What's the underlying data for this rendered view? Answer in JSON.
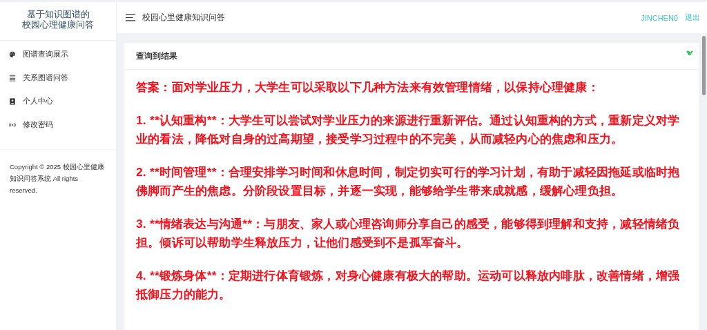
{
  "sidebar": {
    "title_lines": [
      "基于知识图谱的",
      "校园心理健康问答"
    ],
    "items": [
      {
        "label": "图谱查询展示"
      },
      {
        "label": "关系图谱问答"
      },
      {
        "label": "个人中心"
      },
      {
        "label": "修改密码"
      }
    ],
    "copyright": "Copyright © 2025 校园心里健康知识问答系统 All rights reserved."
  },
  "header": {
    "title": "校园心里健康知识问答",
    "user": "JINCHEN0",
    "logout": "退出"
  },
  "card": {
    "title": "查询到结果",
    "paragraphs": [
      "答案：面对学业压力，大学生可以采取以下几种方法来有效管理情绪，以保持心理健康：",
      "1. **认知重构**：大学生可以尝试对学业压力的来源进行重新评估。通过认知重构的方式，重新定义对学业的看法，降低对自身的过高期望，接受学习过程中的不完美，从而减轻内心的焦虑和压力。",
      "2. **时间管理**：合理安排学习时间和休息时间，制定切实可行的学习计划，有助于减轻因拖延或临时抱佛脚而产生的焦虑。分阶段设置目标，并逐一实现，能够给学生带来成就感，缓解心理负担。",
      "3. **情绪表达与沟通**：与朋友、家人或心理咨询师分享自己的感受，能够得到理解和支持，减轻情绪负担。倾诉可以帮助学生释放压力，让他们感受到不是孤军奋斗。",
      "4. **锻炼身体**：定期进行体育锻炼，对身心健康有极大的帮助。运动可以释放内啡肽，改善情绪，增强抵御压力的能力。"
    ]
  }
}
